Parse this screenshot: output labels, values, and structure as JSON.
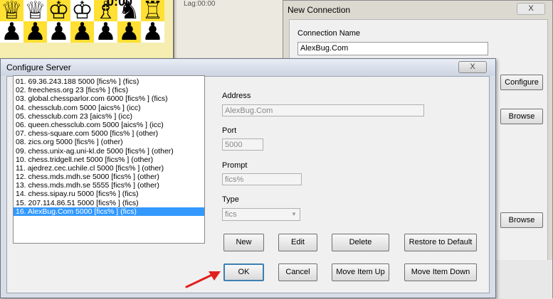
{
  "board": {
    "clock": "0:00",
    "lag": "Lag:00:00",
    "top_row_icons": [
      "white-queen-icon",
      "white-queen-icon",
      "white-king-icon",
      "white-king-icon",
      "white-bishop-icon",
      "black-knight-icon",
      "white-rook-icon"
    ],
    "pawn_row_icons": [
      "black-pawn-icon",
      "black-pawn-icon",
      "black-pawn-icon",
      "black-pawn-icon",
      "black-pawn-icon",
      "black-pawn-icon",
      "black-pawn-icon"
    ]
  },
  "new_connection": {
    "title": "New Connection",
    "close_label": "X",
    "connection_name_label": "Connection Name",
    "connection_name_value": "AlexBug.Com",
    "configure_label": "Configure",
    "browse_label_1": "Browse",
    "browse_label_2": "Browse"
  },
  "configure_server": {
    "title": "Configure Server",
    "close_label": "X",
    "servers": [
      "01. 69.36.243.188 5000 [fics% ] (fics)",
      "02. freechess.org 23 [fics% ] (fics)",
      "03. global.chessparlor.com 6000 [fics% ] (fics)",
      "04. chessclub.com 5000 [aics% ] (icc)",
      "05. chessclub.com 23 [aics% ] (icc)",
      "06. queen.chessclub.com 5000 [aics% ] (icc)",
      "07. chess-square.com 5000 [fics% ] (other)",
      "08. zics.org 5000 [fics% ] (other)",
      "09. chess.unix-ag.uni-kl.de 5000 [fics% ] (other)",
      "10. chess.tridgell.net 5000 [fics% ] (other)",
      "11. ajedrez.cec.uchile.cl 5000 [fics% ] (other)",
      "12. chess.mds.mdh.se 5000 [fics% ] (other)",
      "13. chess.mds.mdh.se 5555 [fics% ] (other)",
      "14. chess.sipay.ru 5000 [fics% ] (fics)",
      "15. 207.114.86.51 5000 [fics% ] (fics)",
      "16. AlexBug.Com 5000 [fics% ] (fics)"
    ],
    "selected_index": 15,
    "address_label": "Address",
    "address_value": "AlexBug.Com",
    "port_label": "Port",
    "port_value": "5000",
    "prompt_label": "Prompt",
    "prompt_value": "fics%",
    "type_label": "Type",
    "type_value": "fics",
    "buttons": {
      "new": "New",
      "edit": "Edit",
      "delete": "Delete",
      "restore": "Restore to Default",
      "ok": "OK",
      "cancel": "Cancel",
      "move_up": "Move Item Up",
      "move_down": "Move Item Down"
    }
  },
  "colors": {
    "selection": "#3399ff",
    "board_yellow": "#ffe033",
    "arrow": "#e02020"
  }
}
